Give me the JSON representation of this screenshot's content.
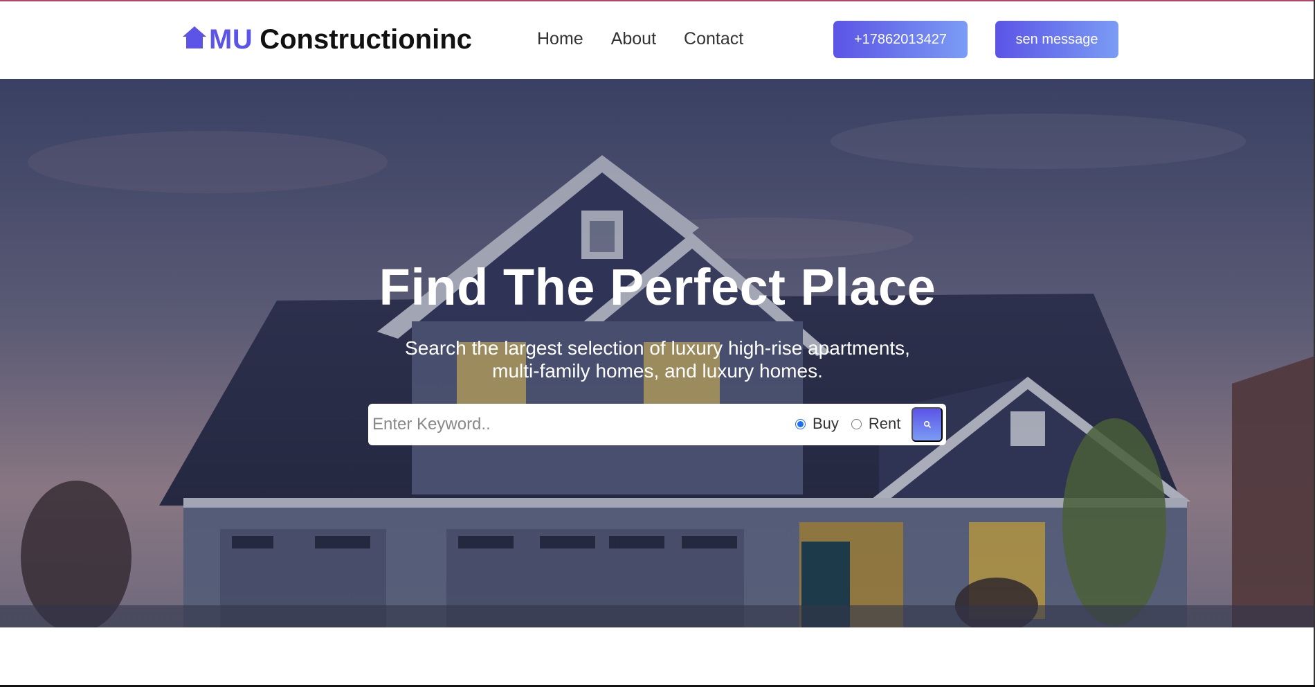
{
  "brand": {
    "icon": "home-icon",
    "accent_text": "MU",
    "name": "Constructioninc",
    "accent_color": "#5b54e6"
  },
  "nav": {
    "items": [
      {
        "label": "Home"
      },
      {
        "label": "About"
      },
      {
        "label": "Contact"
      }
    ]
  },
  "header_buttons": {
    "phone_label": "+17862013427",
    "message_label": "sen message"
  },
  "hero": {
    "title": "Find The Perfect Place",
    "subtitle_line1": "Search the largest selection of luxury high-rise apartments,",
    "subtitle_line2": "multi-family homes, and luxury homes.",
    "background": "house-at-dusk-image"
  },
  "search": {
    "placeholder": "Enter Keyword..",
    "value": "",
    "options": [
      {
        "label": "Buy",
        "selected": true
      },
      {
        "label": "Rent",
        "selected": false
      }
    ],
    "button_icon": "search-icon"
  },
  "colors": {
    "button_gradient_start": "#5b54e6",
    "button_gradient_end": "#7b9cf5",
    "radio_accent": "#1d6ff2"
  }
}
